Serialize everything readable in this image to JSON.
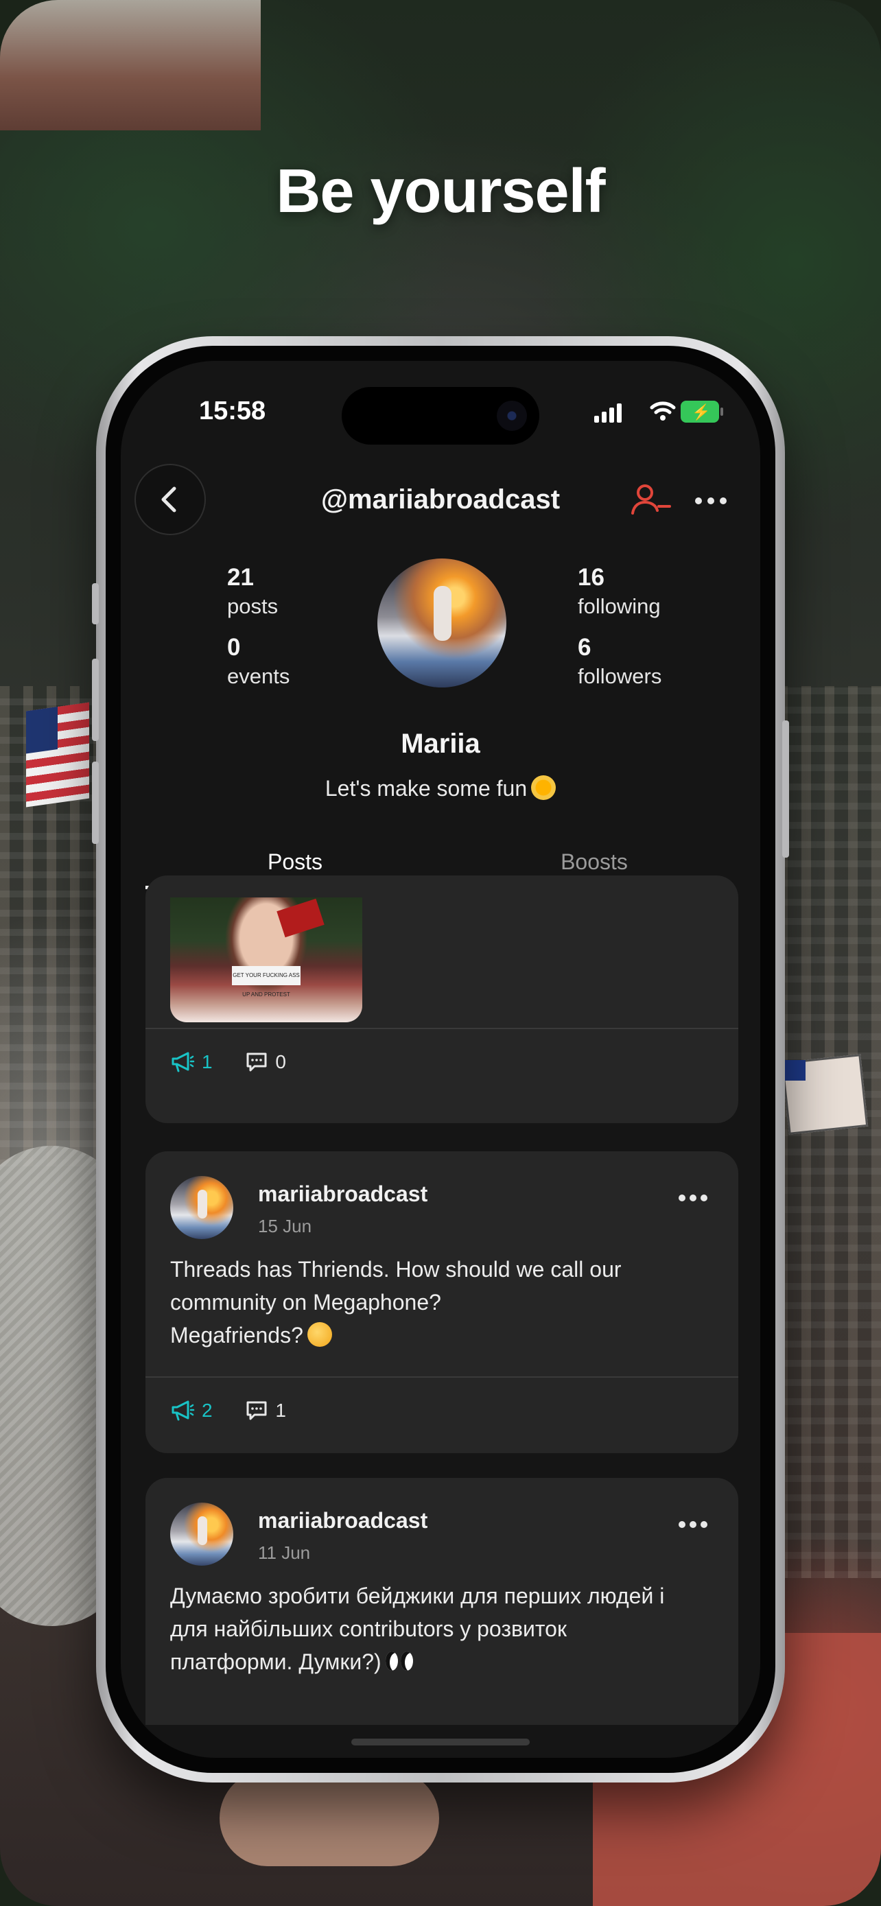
{
  "marketing": {
    "headline": "Be yourself"
  },
  "status_bar": {
    "time": "15:58"
  },
  "profile": {
    "handle": "@mariiabroadcast",
    "name": "Mariia",
    "bio": "Let's make some fun",
    "stats": {
      "posts": {
        "value": "21",
        "label": "posts"
      },
      "events": {
        "value": "0",
        "label": "events"
      },
      "following": {
        "value": "16",
        "label": "following"
      },
      "followers": {
        "value": "6",
        "label": "followers"
      }
    }
  },
  "tabs": [
    {
      "label": "Posts",
      "active": true
    },
    {
      "label": "Boosts",
      "active": false
    }
  ],
  "posts": [
    {
      "partial": true,
      "image_sign_text": "GET YOUR FUCKING ASS UP AND PROTEST",
      "boosts": "1",
      "comments": "0"
    },
    {
      "author": "mariiabroadcast",
      "date": "15 Jun",
      "lines": [
        "Threads has Thriends. How should we call our",
        "community on Megaphone?",
        "Megafriends?"
      ],
      "boosts": "2",
      "comments": "1"
    },
    {
      "author": "mariiabroadcast",
      "date": "11 Jun",
      "lines": [
        "Думаємо зробити бейджики для перших людей і",
        "для найбільших contributors у розвиток",
        "платформи. Думки?)"
      ]
    }
  ],
  "icons": {
    "back": "chevron-left-icon",
    "unfollow": "person-minus-icon",
    "more": "ellipsis-icon",
    "boost": "megaphone-icon",
    "comment": "speech-bubble-icon"
  },
  "colors": {
    "accent_boost": "#19c3c6",
    "unfollow_red": "#e0453a",
    "battery_green": "#35c759",
    "card_bg": "#262626",
    "screen_bg": "#151515"
  }
}
